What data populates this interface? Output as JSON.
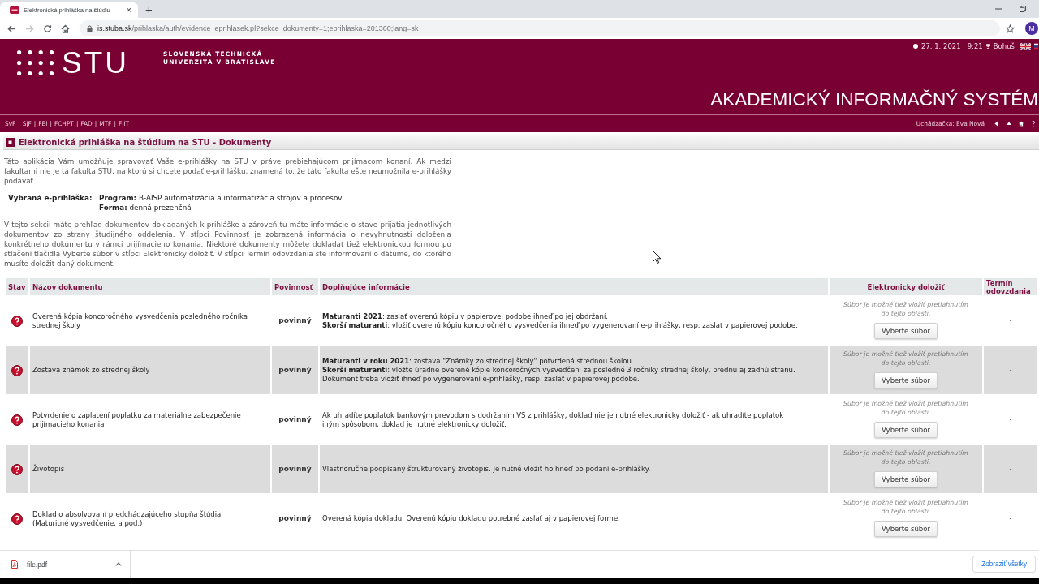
{
  "browser": {
    "tab_title": "Elektronická prihláška na štúdiu",
    "tab_close": "×",
    "new_tab": "+",
    "forward_disabled": true,
    "url": {
      "host": "is.stuba.sk",
      "path": "/prihlaska/auth/evidence_eprihlasek.pl?sekce_dokumenty=1;eprihlaska=201360;lang=sk"
    },
    "profile": "M"
  },
  "header": {
    "logo": "STU",
    "university": [
      "SLOVENSKÁ TECHNICKÁ",
      "UNIVERZITA V BRATISLAVE"
    ],
    "date": "27. 1. 2021",
    "time": "9:21",
    "user": "Bohuš",
    "system_title": "AKADEMICKÝ INFORMAČNÝ SYSTÉM"
  },
  "nav": {
    "faculties": [
      "SvF",
      "SjF",
      "FEI",
      "FCHPT",
      "FAD",
      "MTF",
      "FIIT"
    ],
    "separator": "|",
    "applicant": "Uchádzačka: Eva Nová"
  },
  "page": {
    "title": "Elektronická prihláška na štúdium na STU - Dokumenty",
    "intro": "Táto aplikácia Vám umožňuje spravovať Vaše e-prihlášky na STU v práve prebiehajúcom prijímacom konaní. Ak medzi fakultami nie je tá fakulta STU, na ktorú si chcete podať e-prihlášku, znamená to, že táto fakulta ešte neumožnila e-prihlášky podávať.",
    "selected_application": {
      "label": "Vybraná e-prihláška:",
      "lines": [
        "**Program:** B-AISP automatizácia a informatizácia strojov a procesov",
        "**Forma:** denná prezenčná"
      ]
    },
    "description": "V tejto sekcii máte prehľad dokumentov dokladaných k prihláške a zároveň tu máte informácie o stave prijatia jednotlivých dokumentov zo strany študijného oddelenia. V stĺpci Povinnosť je zobrazená informácia o nevyhnutnosti doloženia konkrétneho dokumentu v rámci prijímacieho konania. Niektoré dokumenty môžete dokladať tiež elektronickou formou po stlačení tlačidla Vyberte súbor v stĺpci Elektronicky doložiť. V stĺpci Termín odovzdania ste informovaní o dátume, do ktorého musíte doložiť daný dokument."
  },
  "table": {
    "columns": [
      "Stav",
      "Názov dokumentu",
      "Povinnosť",
      "Doplňujúce informácie",
      "Elektronicky doložiť",
      "Termín odovzdania"
    ],
    "rows": [
      {
        "delivered": false,
        "name": "Overená kópia koncoročného vysvedčenia posledného ročníka strednej školy",
        "obligation": "povinný",
        "info": [
          "**Maturanti 2021**: zaslať overenú kópiu v papierovej podobe ihneď po jej obdržaní.",
          "**Skorší maturanti**: vložiť overenú kópiu koncoročného vysvedčenia ihneď po vygenerovaní e-prihlášky, resp. zaslať v papierovej podobe."
        ],
        "upload_hint": "Súbor je možné tiež vložiť pretiahnutím do tejto oblasti.",
        "upload_button": "Vyberte súbor",
        "deadline": "-"
      },
      {
        "delivered": false,
        "name": "Zostava známok zo strednej školy",
        "obligation": "povinný",
        "info": [
          "**Maturanti v roku 2021**: zostava \"Známky zo strednej školy\" potvrdená strednou školou.",
          "**Skorší maturanti**: vložte úradne overené kópie koncoročných vysvedčení za posledné 3 ročníky strednej školy, prednú aj zadnú stranu. Dokument treba vložiť ihneď po vygenerovaní e-prihlášky, resp. zaslať v papierovej podobe."
        ],
        "upload_hint": "Súbor je možné tiež vložiť pretiahnutím do tejto oblasti.",
        "upload_button": "Vyberte súbor",
        "deadline": "-"
      },
      {
        "delivered": false,
        "name": "Potvrdenie o zaplatení poplatku za materiálne zabezpečenie prijímacieho konania",
        "obligation": "povinný",
        "info": [
          "Ak uhradíte poplatok bankovým prevodom s dodržaním VS z prihlášky, doklad nie je nutné elektronicky doložiť - ak uhradíte poplatok iným spôsobom, doklad je nutné elektronicky doložiť."
        ],
        "upload_hint": "Súbor je možné tiež vložiť pretiahnutím do tejto oblasti.",
        "upload_button": "Vyberte súbor",
        "deadline": "-"
      },
      {
        "delivered": false,
        "name": "Životopis",
        "obligation": "povinný",
        "info": [
          "Vlastnoručne podpísaný štrukturovaný životopis. Je nutné vložiť ho hneď po podaní e-prihlášky."
        ],
        "upload_hint": "Súbor je možné tiež vložiť pretiahnutím do tejto oblasti.",
        "upload_button": "Vyberte súbor",
        "deadline": "-"
      },
      {
        "delivered": false,
        "name": "Doklad o absolvovaní predchádzajúceho stupňa štúdia (Maturitné vysvedčenie, a pod.)",
        "obligation": "povinný",
        "info": [
          "Overená kópia dokladu. Overenú kópiu dokladu potrebné zaslať aj v papierovej forme."
        ],
        "upload_hint": "Súbor je možné tiež vložiť pretiahnutím do tejto oblasti.",
        "upload_button": "Vyberte súbor",
        "deadline": "-"
      }
    ]
  },
  "downloads": {
    "file": "file.pdf",
    "show_all": "Zobraziť všetky"
  }
}
